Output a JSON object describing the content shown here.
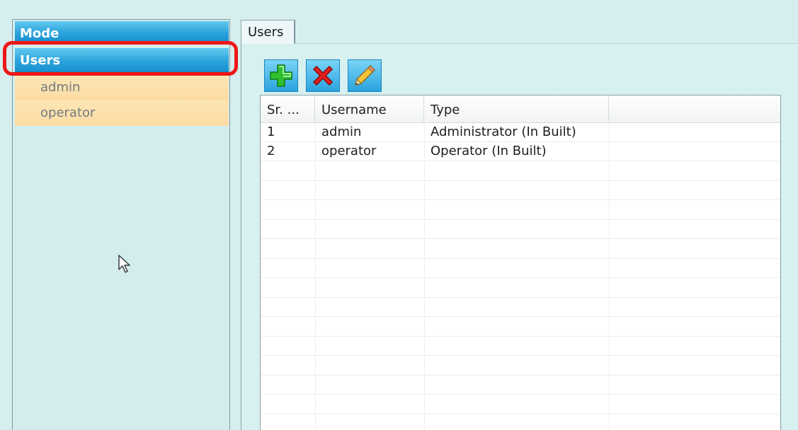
{
  "sidebar": {
    "mode_header": "Mode",
    "users_header": "Users",
    "items": [
      {
        "label": "admin"
      },
      {
        "label": "operator"
      }
    ]
  },
  "tabs": [
    {
      "label": "Users",
      "selected": true
    }
  ],
  "toolbar": {
    "add_icon": "green-plus-icon",
    "delete_icon": "red-x-icon",
    "edit_icon": "pencil-icon"
  },
  "table": {
    "columns": [
      "Sr. ...",
      "Username",
      "Type",
      ""
    ],
    "rows": [
      [
        "1",
        "admin",
        "Administrator (In Built)"
      ],
      [
        "2",
        "operator",
        "Operator (In Built)"
      ]
    ]
  },
  "colors": {
    "header_blue": "#2ca4dc",
    "item_orange": "#fbdca3",
    "highlight_red": "#ee1717",
    "panel_bg": "#d6eeee"
  }
}
